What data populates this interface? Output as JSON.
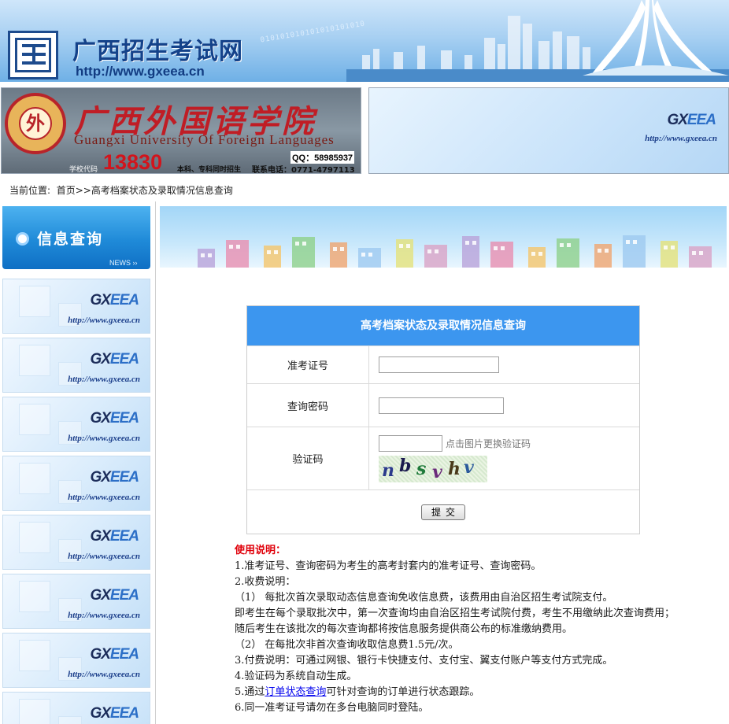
{
  "header": {
    "site_title": "广西招生考试网",
    "site_url": "http://www.gxeea.cn",
    "binary_text": "010101010101010101010"
  },
  "banner_left": {
    "university_cn": "广西外国语学院",
    "university_en": "Guangxi University Of Foreign Languages",
    "emblem_char": "外",
    "qq": "QQ：58985937",
    "code_label": "学校代码",
    "school_code": "13830",
    "enroll_type": "本科、专科同时招生",
    "tel": "联系电话：0771-4797113"
  },
  "gxeea_tile": {
    "logo_gx": "GX",
    "logo_eea": "EEA",
    "url": "http://www.gxeea.cn"
  },
  "breadcrumb": {
    "label": "当前位置:",
    "home": "首页",
    "separator": ">>",
    "current": "高考档案状态及录取情况信息查询"
  },
  "sidebar": {
    "title": "信息查询",
    "news": "NEWS ››"
  },
  "form": {
    "title": "高考档案状态及录取情况信息查询",
    "exam_no_label": "准考证号",
    "exam_no_value": "",
    "password_label": "查询密码",
    "password_value": "",
    "captcha_label": "验证码",
    "captcha_value": "",
    "captcha_hint": "点击图片更换验证码",
    "captcha_chars": [
      "n",
      "b",
      "s",
      "v",
      "h",
      "v"
    ],
    "submit_label": "提交"
  },
  "instructions": {
    "heading": "使用说明：",
    "line1": "1.准考证号、查询密码为考生的高考封套内的准考证号、查询密码。",
    "line2": "2.收费说明：",
    "line3": "（1） 每批次首次录取动态信息查询免收信息费，该费用由自治区招生考试院支付。",
    "line4": "即考生在每个录取批次中，第一次查询均由自治区招生考试院付费，考生不用缴纳此次查询费用；",
    "line5": "随后考生在该批次的每次查询都将按信息服务提供商公布的标准缴纳费用。",
    "line6": "（2） 在每批次非首次查询收取信息费1.5元/次。",
    "line7": "3.付费说明：可通过网银、银行卡快捷支付、支付宝、翼支付账户等支付方式完成。",
    "line8": "4.验证码为系统自动生成。",
    "line9_prefix": "5.通过",
    "line9_link": "订单状态查询",
    "line9_suffix": "可针对查询的订单进行状态跟踪。",
    "line10": "6.同一准考证号请勿在多台电脑同时登陆。"
  },
  "colors": {
    "form_header": "#3c96ef",
    "instruction_heading": "#e0000a",
    "title_blue": "#14428a"
  }
}
